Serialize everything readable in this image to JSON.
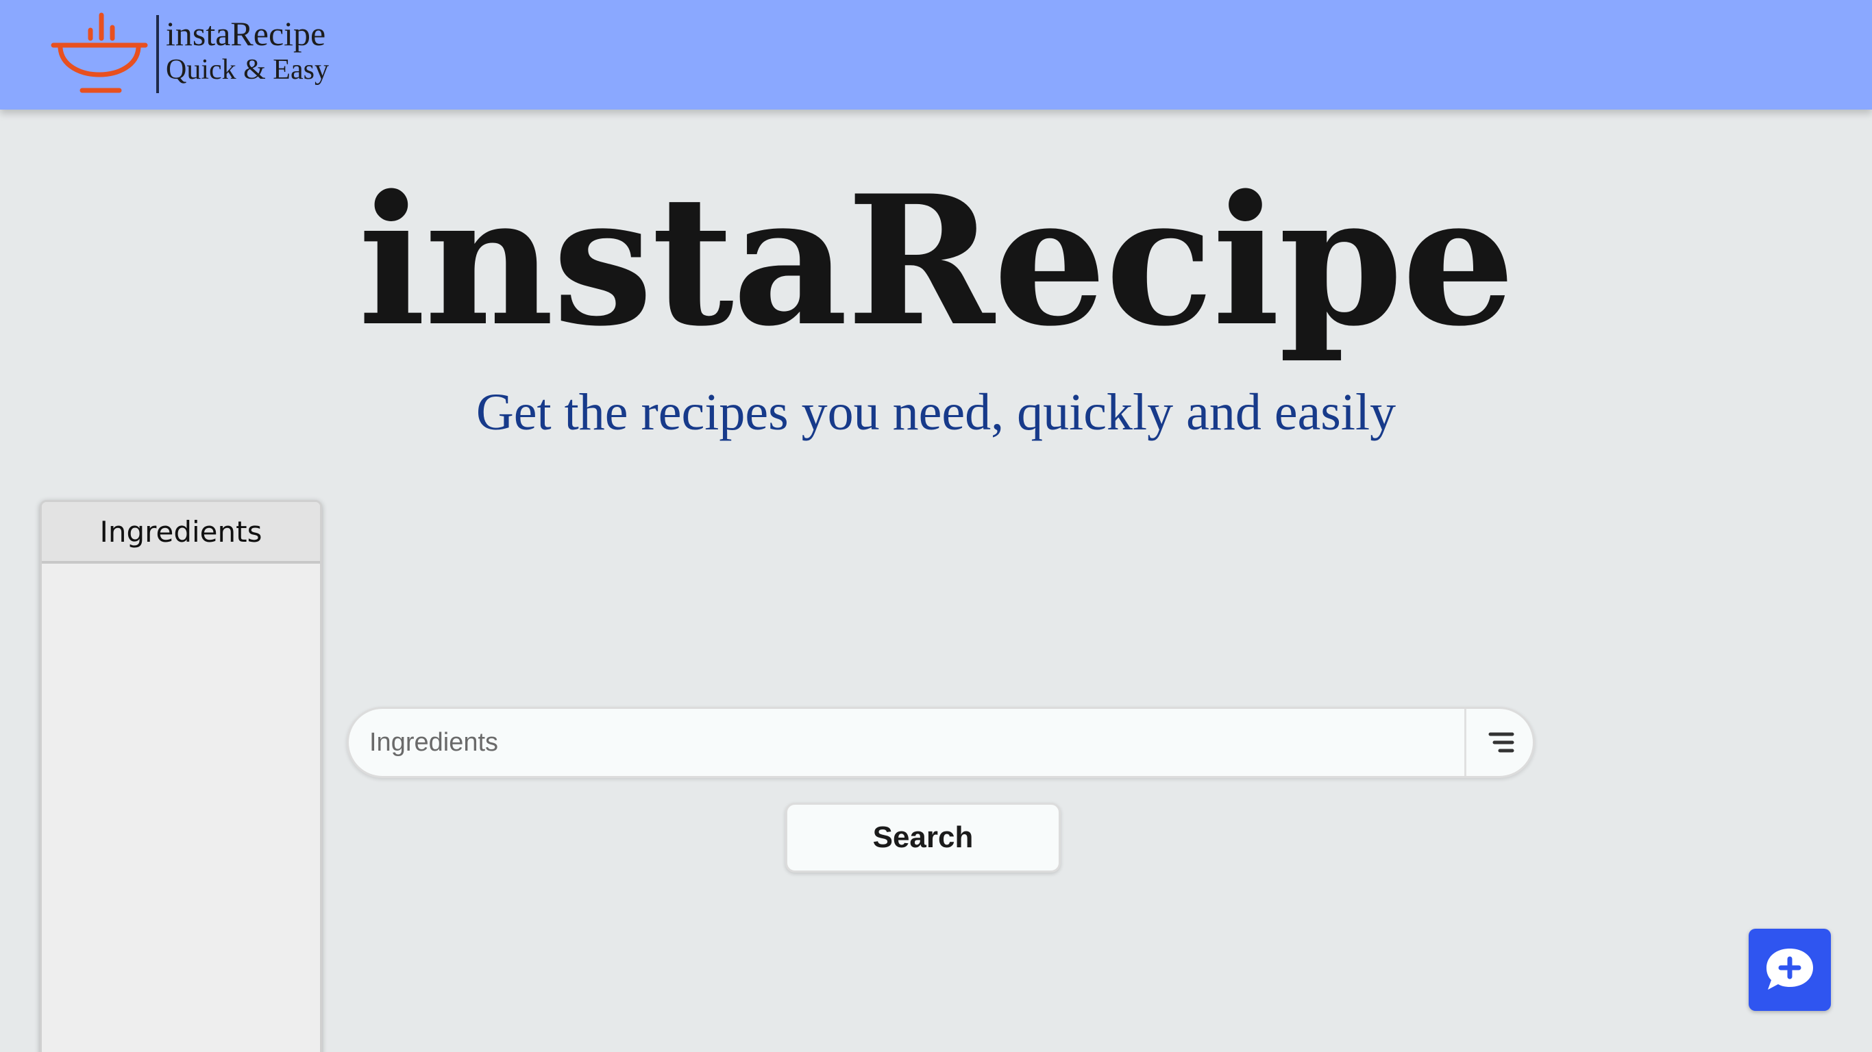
{
  "header": {
    "logo_title": "instaRecipe",
    "logo_subtitle": "Quick & Easy",
    "logo_icon": "bowl-icon",
    "background_color": "#8aa8ff",
    "icon_color": "#e8501f"
  },
  "hero": {
    "title": "instaRecipe",
    "subtitle": "Get the recipes you need, quickly and easily",
    "subtitle_color": "#173a8a"
  },
  "ingredients_panel": {
    "title": "Ingredients",
    "items": []
  },
  "search": {
    "placeholder": "Ingredients",
    "value": "",
    "filter_icon": "filter-icon",
    "button_label": "Search"
  },
  "chat": {
    "icon": "chat-plus-icon",
    "color": "#2f55f0"
  }
}
